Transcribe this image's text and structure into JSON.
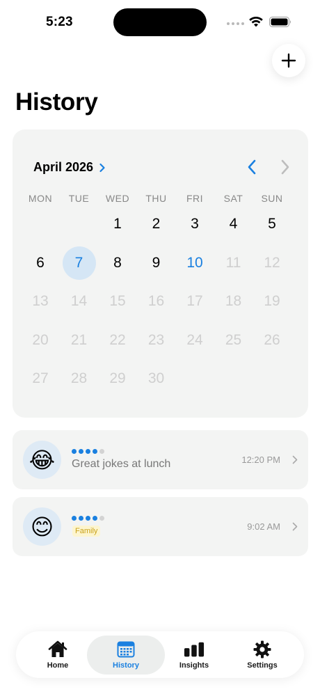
{
  "status_bar": {
    "time": "5:23"
  },
  "header": {
    "title": "History"
  },
  "calendar": {
    "month": "April 2026",
    "weekdays": [
      "MON",
      "TUE",
      "WED",
      "THU",
      "FRI",
      "SAT",
      "SUN"
    ],
    "weeks": [
      [
        "",
        "",
        "1",
        "2",
        "3",
        "4",
        "5"
      ],
      [
        "6",
        "7",
        "8",
        "9",
        "10",
        "11",
        "12"
      ],
      [
        "13",
        "14",
        "15",
        "16",
        "17",
        "18",
        "19"
      ],
      [
        "20",
        "21",
        "22",
        "23",
        "24",
        "25",
        "26"
      ],
      [
        "27",
        "28",
        "29",
        "30",
        "",
        "",
        ""
      ]
    ],
    "selected_day": "7",
    "highlighted_day": "10",
    "last_enabled_day": 10
  },
  "entries": [
    {
      "emoji": "😂",
      "rating": 4,
      "rating_max": 5,
      "note": "Great jokes at lunch",
      "tag": "",
      "time": "12:20 PM"
    },
    {
      "emoji": "😊",
      "rating": 4,
      "rating_max": 5,
      "note": "",
      "tag": "Family",
      "time": "9:02 AM"
    }
  ],
  "tabs": [
    {
      "label": "Home",
      "icon": "house-icon",
      "active": false
    },
    {
      "label": "History",
      "icon": "calendar-icon",
      "active": true
    },
    {
      "label": "Insights",
      "icon": "bar-chart-icon",
      "active": false
    },
    {
      "label": "Settings",
      "icon": "gear-icon",
      "active": false
    }
  ],
  "colors": {
    "accent": "#1a80e0",
    "card": "#f3f4f3",
    "selected_bg": "#d5e6f5",
    "tag_bg": "#fdf5cf",
    "tag_text": "#c9a21a"
  }
}
